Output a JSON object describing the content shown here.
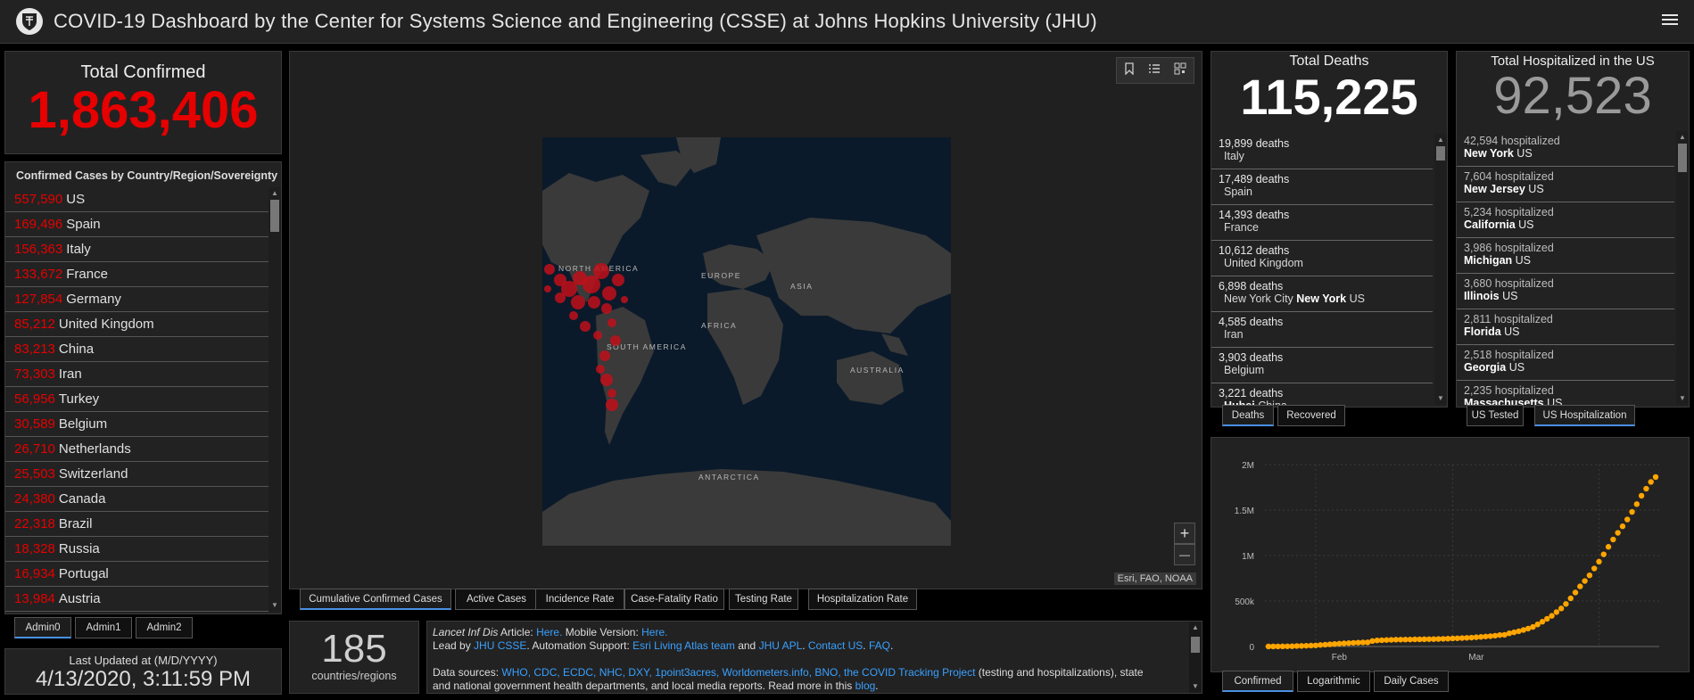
{
  "header": {
    "title": "COVID-19 Dashboard by the Center for Systems Science and Engineering (CSSE) at Johns Hopkins University (JHU)"
  },
  "total_confirmed": {
    "label": "Total Confirmed",
    "value": "1,863,406"
  },
  "country_list": {
    "title": "Confirmed Cases by Country/Region/Sovereignty",
    "items": [
      {
        "num": "557,590",
        "name": "US"
      },
      {
        "num": "169,496",
        "name": "Spain"
      },
      {
        "num": "156,363",
        "name": "Italy"
      },
      {
        "num": "133,672",
        "name": "France"
      },
      {
        "num": "127,854",
        "name": "Germany"
      },
      {
        "num": "85,212",
        "name": "United Kingdom"
      },
      {
        "num": "83,213",
        "name": "China"
      },
      {
        "num": "73,303",
        "name": "Iran"
      },
      {
        "num": "56,956",
        "name": "Turkey"
      },
      {
        "num": "30,589",
        "name": "Belgium"
      },
      {
        "num": "26,710",
        "name": "Netherlands"
      },
      {
        "num": "25,503",
        "name": "Switzerland"
      },
      {
        "num": "24,380",
        "name": "Canada"
      },
      {
        "num": "22,318",
        "name": "Brazil"
      },
      {
        "num": "18,328",
        "name": "Russia"
      },
      {
        "num": "16,934",
        "name": "Portugal"
      },
      {
        "num": "13,984",
        "name": "Austria"
      }
    ]
  },
  "admin_tabs": [
    "Admin0",
    "Admin1",
    "Admin2"
  ],
  "last_updated": {
    "label": "Last Updated at (M/D/YYYY)",
    "value": "4/13/2020, 3:11:59 PM"
  },
  "countries": {
    "value": "185",
    "label": "countries/regions"
  },
  "map": {
    "labels": {
      "north_america": "NORTH AMERICA",
      "south_america": "SOUTH AMERICA",
      "europe": "EUROPE",
      "asia": "ASIA",
      "africa": "AFRICA",
      "australia": "AUSTRALIA",
      "antarctica": "ANTARCTICA"
    },
    "attribution": "Esri, FAO, NOAA",
    "zoom_in": "+",
    "zoom_out": "—",
    "tabs": [
      "Cumulative Confirmed Cases",
      "Active Cases",
      "Incidence Rate",
      "Case-Fatality Ratio",
      "Testing Rate",
      "Hospitalization Rate"
    ]
  },
  "info": {
    "line1_a": "Lancet Inf Dis",
    "line1_b": " Article: ",
    "line1_c": "Here.",
    "line1_d": " Mobile Version: ",
    "line1_e": "Here.",
    "line2_a": "Lead by ",
    "line2_b": "JHU CSSE",
    "line2_c": ". Automation Support: ",
    "line2_d": "Esri Living Atlas team",
    "line2_e": " and ",
    "line2_f": "JHU APL",
    "line2_g": ". ",
    "line2_h": "Contact US",
    "line2_i": ". ",
    "line2_j": "FAQ",
    "line2_k": ".",
    "line3_a": "Data sources: ",
    "line3_b": "WHO, CDC, ECDC, NHC, DXY, 1point3acres, Worldometers.info, BNO, the COVID Tracking Project",
    "line3_c": " (testing and hospitalizations), state",
    "line4_a": "and national government health departments, and local media reports.  Read more in this ",
    "line4_b": "blog",
    "line4_c": "."
  },
  "deaths": {
    "label": "Total Deaths",
    "value": "115,225",
    "items": [
      {
        "num": "19,899 deaths",
        "pre": "Italy",
        "bold": "",
        "post": ""
      },
      {
        "num": "17,489 deaths",
        "pre": "Spain",
        "bold": "",
        "post": ""
      },
      {
        "num": "14,393 deaths",
        "pre": "France",
        "bold": "",
        "post": ""
      },
      {
        "num": "10,612 deaths",
        "pre": "United Kingdom",
        "bold": "",
        "post": ""
      },
      {
        "num": "6,898 deaths",
        "pre": "New York City ",
        "bold": "New York",
        "post": " US"
      },
      {
        "num": "4,585 deaths",
        "pre": "Iran",
        "bold": "",
        "post": ""
      },
      {
        "num": "3,903 deaths",
        "pre": "Belgium",
        "bold": "",
        "post": ""
      },
      {
        "num": "3,221 deaths",
        "pre": "",
        "bold": "Hubei",
        "post": " China"
      }
    ],
    "tabs": [
      "Deaths",
      "Recovered"
    ]
  },
  "hospitalized": {
    "label": "Total Hospitalized in the US",
    "value": "92,523",
    "items": [
      {
        "num": "42,594 hospitalized",
        "state": "New York",
        "country": " US"
      },
      {
        "num": "7,604 hospitalized",
        "state": "New Jersey",
        "country": " US"
      },
      {
        "num": "5,234 hospitalized",
        "state": "California",
        "country": " US"
      },
      {
        "num": "3,986 hospitalized",
        "state": "Michigan",
        "country": " US"
      },
      {
        "num": "3,680 hospitalized",
        "state": "Illinois",
        "country": " US"
      },
      {
        "num": "2,811 hospitalized",
        "state": "Florida",
        "country": " US"
      },
      {
        "num": "2,518 hospitalized",
        "state": "Georgia",
        "country": " US"
      },
      {
        "num": "2,235 hospitalized",
        "state": "Massachusetts",
        "country": " US"
      }
    ],
    "tabs": [
      "US Tested",
      "US Hospitalization"
    ]
  },
  "chart_tabs": [
    "Confirmed",
    "Logarithmic",
    "Daily Cases"
  ],
  "colors": {
    "accent_red": "#e60000",
    "link_blue": "#3aa0ff",
    "chart_orange": "#ffa500",
    "tab_underline": "#4a90e2"
  },
  "chart_data": {
    "type": "scatter",
    "title": "",
    "xlabel": "",
    "ylabel": "",
    "x_tick_labels": [
      "Feb",
      "Mar"
    ],
    "y_tick_labels": [
      "0",
      "500k",
      "1M",
      "1.5M",
      "2M"
    ],
    "ylim": [
      0,
      2000000
    ],
    "x": [
      "1/22",
      "1/23",
      "1/24",
      "1/25",
      "1/26",
      "1/27",
      "1/28",
      "1/29",
      "1/30",
      "1/31",
      "2/1",
      "2/2",
      "2/3",
      "2/4",
      "2/5",
      "2/6",
      "2/7",
      "2/8",
      "2/9",
      "2/10",
      "2/11",
      "2/12",
      "2/13",
      "2/14",
      "2/15",
      "2/16",
      "2/17",
      "2/18",
      "2/19",
      "2/20",
      "2/21",
      "2/22",
      "2/23",
      "2/24",
      "2/25",
      "2/26",
      "2/27",
      "2/28",
      "2/29",
      "3/1",
      "3/2",
      "3/3",
      "3/4",
      "3/5",
      "3/6",
      "3/7",
      "3/8",
      "3/9",
      "3/10",
      "3/11",
      "3/12",
      "3/13",
      "3/14",
      "3/15",
      "3/16",
      "3/17",
      "3/18",
      "3/19",
      "3/20",
      "3/21",
      "3/22",
      "3/23",
      "3/24",
      "3/25",
      "3/26",
      "3/27",
      "3/28",
      "3/29",
      "3/30",
      "3/31",
      "4/1",
      "4/2",
      "4/3",
      "4/4",
      "4/5",
      "4/6",
      "4/7",
      "4/8",
      "4/9",
      "4/10",
      "4/11",
      "4/12",
      "4/13"
    ],
    "values": [
      555,
      654,
      941,
      1434,
      2118,
      2927,
      5578,
      6166,
      8234,
      9927,
      12038,
      16787,
      19881,
      23892,
      27635,
      30817,
      34391,
      37120,
      40150,
      42762,
      44802,
      45221,
      60368,
      66885,
      69030,
      71224,
      73258,
      75136,
      75639,
      76197,
      76819,
      78572,
      78958,
      79561,
      80406,
      81388,
      82746,
      84112,
      86011,
      88369,
      90306,
      92840,
      95120,
      97886,
      101801,
      105847,
      109821,
      113590,
      118620,
      125875,
      128352,
      145205,
      156101,
      167454,
      181574,
      197102,
      214821,
      242570,
      272208,
      304507,
      336953,
      378235,
      418045,
      467653,
      529591,
      593291,
      660706,
      720117,
      782365,
      857487,
      932605,
      1013157,
      1095917,
      1176060,
      1249754,
      1321481,
      1396476,
      1479804,
      1565278,
      1657526,
      1734913,
      1809000,
      1863406
    ]
  }
}
